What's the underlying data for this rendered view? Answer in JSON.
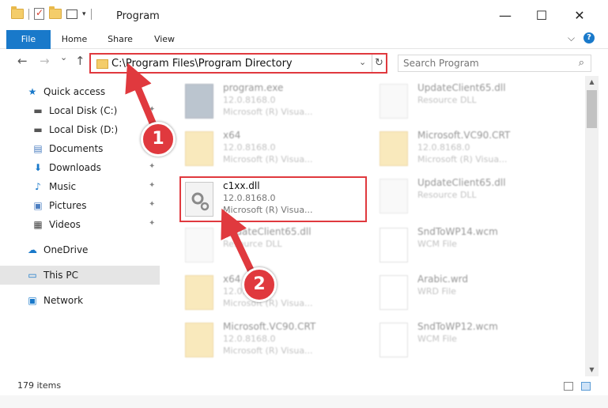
{
  "window": {
    "title": "Program",
    "minimize_glyph": "—",
    "maximize_glyph": "☐",
    "close_glyph": "✕"
  },
  "ribbon": {
    "tabs": [
      "File",
      "Home",
      "Share",
      "View"
    ],
    "collapse_glyph": "⌵",
    "help_glyph": "?"
  },
  "nav": {
    "back_glyph": "←",
    "forward_glyph": "→",
    "recent_glyph": "⌄",
    "up_glyph": "↑",
    "address_path": "C:\\Program Files\\Program Directory",
    "dropdown_glyph": "⌄",
    "refresh_glyph": "↻",
    "search_placeholder": "Search Program",
    "search_glyph": "⌕"
  },
  "sidebar": {
    "items": [
      {
        "label": "Quick access",
        "icon": "star-icon",
        "glyph": "★",
        "color": "#1979ca"
      },
      {
        "label": "Local Disk (C:)",
        "icon": "drive-icon",
        "glyph": "▬",
        "color": "#555555",
        "pinned": true
      },
      {
        "label": "Local Disk (D:)",
        "icon": "drive-icon",
        "glyph": "▬",
        "color": "#555555"
      },
      {
        "label": "Documents",
        "icon": "documents-icon",
        "glyph": "▤",
        "color": "#4d7fc1",
        "pinned": true
      },
      {
        "label": "Downloads",
        "icon": "download-icon",
        "glyph": "⬇",
        "color": "#1979ca",
        "pinned": true
      },
      {
        "label": "Music",
        "icon": "music-icon",
        "glyph": "♪",
        "color": "#1979ca",
        "pinned": true
      },
      {
        "label": "Pictures",
        "icon": "pictures-icon",
        "glyph": "▣",
        "color": "#4d7fc1",
        "pinned": true
      },
      {
        "label": "Videos",
        "icon": "videos-icon",
        "glyph": "▦",
        "color": "#444444",
        "pinned": true
      },
      {
        "label": "OneDrive",
        "icon": "cloud-icon",
        "glyph": "☁",
        "color": "#1979ca"
      },
      {
        "label": "This PC",
        "icon": "computer-icon",
        "glyph": "▭",
        "color": "#1979ca",
        "selected": true
      },
      {
        "label": "Network",
        "icon": "network-icon",
        "glyph": "▣",
        "color": "#1979ca"
      }
    ],
    "pin_glyph": "📌"
  },
  "files": [
    {
      "name": "program.exe",
      "line2": "12.0.8168.0",
      "line3": "Microsoft (R) Visua...",
      "type": "exe"
    },
    {
      "name": "UpdateClient65.dll",
      "line2": "Resource DLL",
      "line3": "",
      "type": "dll"
    },
    {
      "name": "x64",
      "line2": "12.0.8168.0",
      "line3": "Microsoft (R) Visua...",
      "type": "folder"
    },
    {
      "name": "Microsoft.VC90.CRT",
      "line2": "12.0.8168.0",
      "line3": "Microsoft (R) Visua...",
      "type": "folder"
    },
    {
      "name": "c1xx.dll",
      "line2": "12.0.8168.0",
      "line3": "Microsoft (R) Visua...",
      "type": "dll",
      "highlighted": true
    },
    {
      "name": "UpdateClient65.dll",
      "line2": "Resource DLL",
      "line3": "",
      "type": "dll"
    },
    {
      "name": "UpdateClient65.dll",
      "line2": "Resource DLL",
      "line3": "",
      "type": "dll"
    },
    {
      "name": "SndToWP14.wcm",
      "line2": "WCM File",
      "line3": "",
      "type": "doc"
    },
    {
      "name": "x64",
      "line2": "12.0.8168.0",
      "line3": "Microsoft (R) Visua...",
      "type": "folder"
    },
    {
      "name": "Arabic.wrd",
      "line2": "WRD File",
      "line3": "",
      "type": "doc"
    },
    {
      "name": "Microsoft.VC90.CRT",
      "line2": "12.0.8168.0",
      "line3": "Microsoft (R) Visua...",
      "type": "folder"
    },
    {
      "name": "SndToWP12.wcm",
      "line2": "WCM File",
      "line3": "",
      "type": "doc"
    }
  ],
  "status": {
    "item_count": "179 items"
  },
  "annotations": {
    "badge_1": "1",
    "badge_2": "2",
    "color": "#e0393e"
  },
  "scroll": {
    "up_glyph": "▲",
    "down_glyph": "▼"
  }
}
